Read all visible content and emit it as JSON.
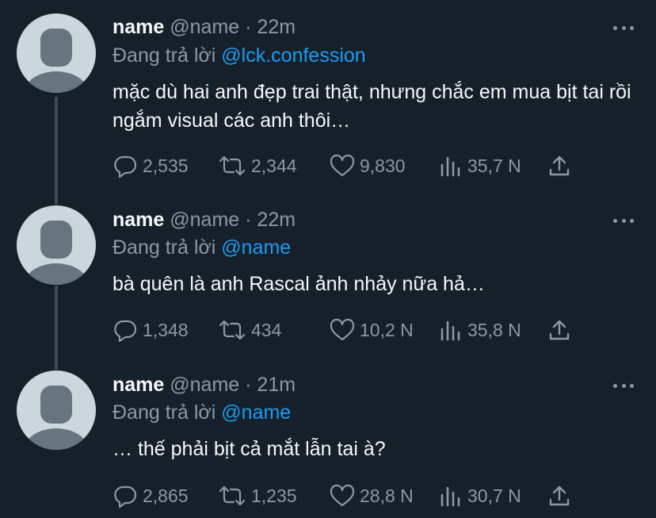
{
  "tweets": [
    {
      "name": "name",
      "handle": "@name",
      "separator": "·",
      "time": "22m",
      "replying_prefix": "Đang trả lời",
      "replying_to": "@lck.confession",
      "text": "mặc dù hai anh đẹp trai thật, nhưng chắc em mua bịt tai rồi ngắm visual các anh thôi…",
      "replies": "2,535",
      "retweets": "2,344",
      "likes": "9,830",
      "views": "35,7 N"
    },
    {
      "name": "name",
      "handle": "@name",
      "separator": "·",
      "time": "22m",
      "replying_prefix": "Đang trả lời",
      "replying_to": "@name",
      "text": "bà quên là anh Rascal ảnh nhảy nữa hả…",
      "replies": "1,348",
      "retweets": "434",
      "likes": "10,2 N",
      "views": "35,8 N"
    },
    {
      "name": "name",
      "handle": "@name",
      "separator": "·",
      "time": "21m",
      "replying_prefix": "Đang trả lời",
      "replying_to": "@name",
      "text": "… thế phải bịt cả mắt lẫn tai à?",
      "replies": "2,865",
      "retweets": "1,235",
      "likes": "28,8 N",
      "views": "30,7 N"
    }
  ],
  "colors": {
    "background": "#15202b",
    "primary_text": "#f7f9f9",
    "secondary_text": "#8b98a5",
    "link": "#1d9bf0",
    "thread_line": "#3d4a57",
    "avatar_bg": "#ccd6dd",
    "avatar_fg": "#66757f"
  }
}
